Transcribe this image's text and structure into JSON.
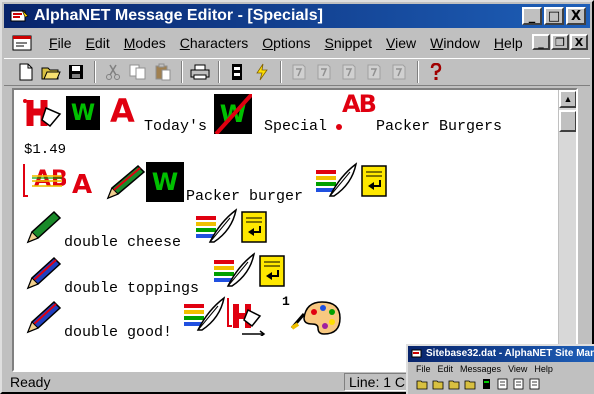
{
  "window": {
    "title": "AlphaNET Message Editor - [Specials]"
  },
  "title_buttons": {
    "minimize": "_",
    "maximize": "□",
    "close": "X"
  },
  "menu": {
    "items": [
      {
        "ul": "F",
        "rest": "ile"
      },
      {
        "ul": "E",
        "rest": "dit"
      },
      {
        "ul": "M",
        "rest": "odes"
      },
      {
        "ul": "C",
        "rest": "haracters"
      },
      {
        "ul": "O",
        "rest": "ptions"
      },
      {
        "ul": "S",
        "rest": "nippet"
      },
      {
        "ul": "V",
        "rest": "iew"
      },
      {
        "ul": "W",
        "rest": "indow"
      },
      {
        "ul": "H",
        "rest": "elp"
      }
    ]
  },
  "mdi_buttons": {
    "minimize": "_",
    "restore": "❐",
    "close": "X"
  },
  "toolbar": {
    "icons": [
      "new-icon",
      "open-icon",
      "save-icon",
      "cut-icon",
      "copy-icon",
      "paste-icon",
      "print-icon",
      "transmit-icon",
      "lightning-icon",
      "format-1-icon",
      "format-2-icon",
      "format-3-icon",
      "format-4-icon",
      "format-5-icon",
      "help-icon"
    ]
  },
  "editor": {
    "line1": {
      "w1": "W",
      "w2": "W",
      "a": "A",
      "todays": "Today's",
      "special": "Special",
      "ab": "AB",
      "packer": "Packer Burgers"
    },
    "line2": {
      "price": "$1.49"
    },
    "line3": {
      "ab": "AB",
      "a": "A",
      "w": "W",
      "packer_burger": "Packer burger"
    },
    "line4": {
      "text": "double cheese"
    },
    "line5": {
      "text": "double toppings"
    },
    "line6": {
      "text": "double good!",
      "sup": "1"
    }
  },
  "status": {
    "ready": "Ready",
    "line": "Line: 1  C"
  },
  "mini_window": {
    "title": "Sitebase32.dat - AlphaNET Site Man",
    "menu": [
      "File",
      "Edit",
      "Messages",
      "View",
      "Help"
    ]
  },
  "colors": {
    "titlebar": "#08246b",
    "accent_red": "#e00010",
    "accent_green": "#00c000",
    "chrome": "#c0c0c0"
  }
}
